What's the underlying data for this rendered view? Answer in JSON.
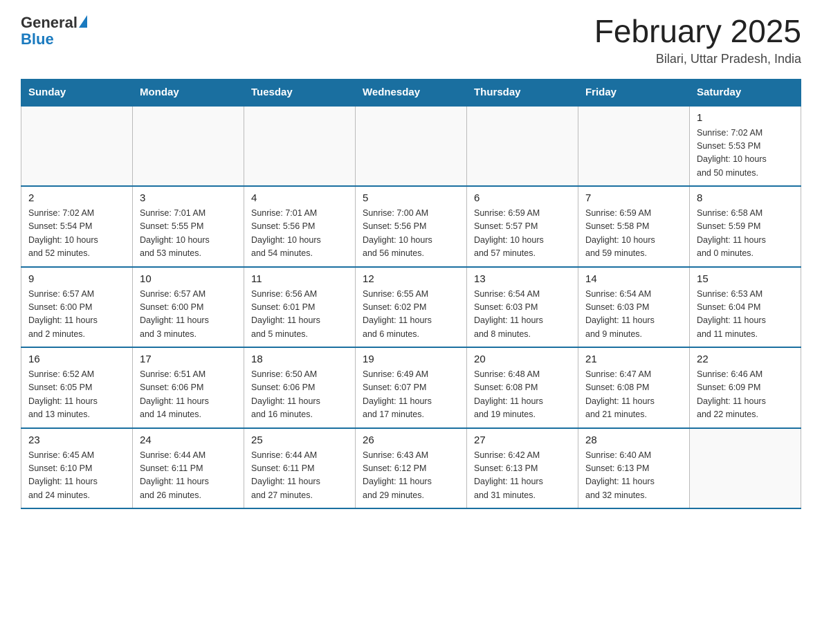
{
  "header": {
    "logo_general": "General",
    "logo_blue": "Blue",
    "title": "February 2025",
    "subtitle": "Bilari, Uttar Pradesh, India"
  },
  "weekdays": [
    "Sunday",
    "Monday",
    "Tuesday",
    "Wednesday",
    "Thursday",
    "Friday",
    "Saturday"
  ],
  "weeks": [
    [
      {
        "day": "",
        "info": ""
      },
      {
        "day": "",
        "info": ""
      },
      {
        "day": "",
        "info": ""
      },
      {
        "day": "",
        "info": ""
      },
      {
        "day": "",
        "info": ""
      },
      {
        "day": "",
        "info": ""
      },
      {
        "day": "1",
        "info": "Sunrise: 7:02 AM\nSunset: 5:53 PM\nDaylight: 10 hours\nand 50 minutes."
      }
    ],
    [
      {
        "day": "2",
        "info": "Sunrise: 7:02 AM\nSunset: 5:54 PM\nDaylight: 10 hours\nand 52 minutes."
      },
      {
        "day": "3",
        "info": "Sunrise: 7:01 AM\nSunset: 5:55 PM\nDaylight: 10 hours\nand 53 minutes."
      },
      {
        "day": "4",
        "info": "Sunrise: 7:01 AM\nSunset: 5:56 PM\nDaylight: 10 hours\nand 54 minutes."
      },
      {
        "day": "5",
        "info": "Sunrise: 7:00 AM\nSunset: 5:56 PM\nDaylight: 10 hours\nand 56 minutes."
      },
      {
        "day": "6",
        "info": "Sunrise: 6:59 AM\nSunset: 5:57 PM\nDaylight: 10 hours\nand 57 minutes."
      },
      {
        "day": "7",
        "info": "Sunrise: 6:59 AM\nSunset: 5:58 PM\nDaylight: 10 hours\nand 59 minutes."
      },
      {
        "day": "8",
        "info": "Sunrise: 6:58 AM\nSunset: 5:59 PM\nDaylight: 11 hours\nand 0 minutes."
      }
    ],
    [
      {
        "day": "9",
        "info": "Sunrise: 6:57 AM\nSunset: 6:00 PM\nDaylight: 11 hours\nand 2 minutes."
      },
      {
        "day": "10",
        "info": "Sunrise: 6:57 AM\nSunset: 6:00 PM\nDaylight: 11 hours\nand 3 minutes."
      },
      {
        "day": "11",
        "info": "Sunrise: 6:56 AM\nSunset: 6:01 PM\nDaylight: 11 hours\nand 5 minutes."
      },
      {
        "day": "12",
        "info": "Sunrise: 6:55 AM\nSunset: 6:02 PM\nDaylight: 11 hours\nand 6 minutes."
      },
      {
        "day": "13",
        "info": "Sunrise: 6:54 AM\nSunset: 6:03 PM\nDaylight: 11 hours\nand 8 minutes."
      },
      {
        "day": "14",
        "info": "Sunrise: 6:54 AM\nSunset: 6:03 PM\nDaylight: 11 hours\nand 9 minutes."
      },
      {
        "day": "15",
        "info": "Sunrise: 6:53 AM\nSunset: 6:04 PM\nDaylight: 11 hours\nand 11 minutes."
      }
    ],
    [
      {
        "day": "16",
        "info": "Sunrise: 6:52 AM\nSunset: 6:05 PM\nDaylight: 11 hours\nand 13 minutes."
      },
      {
        "day": "17",
        "info": "Sunrise: 6:51 AM\nSunset: 6:06 PM\nDaylight: 11 hours\nand 14 minutes."
      },
      {
        "day": "18",
        "info": "Sunrise: 6:50 AM\nSunset: 6:06 PM\nDaylight: 11 hours\nand 16 minutes."
      },
      {
        "day": "19",
        "info": "Sunrise: 6:49 AM\nSunset: 6:07 PM\nDaylight: 11 hours\nand 17 minutes."
      },
      {
        "day": "20",
        "info": "Sunrise: 6:48 AM\nSunset: 6:08 PM\nDaylight: 11 hours\nand 19 minutes."
      },
      {
        "day": "21",
        "info": "Sunrise: 6:47 AM\nSunset: 6:08 PM\nDaylight: 11 hours\nand 21 minutes."
      },
      {
        "day": "22",
        "info": "Sunrise: 6:46 AM\nSunset: 6:09 PM\nDaylight: 11 hours\nand 22 minutes."
      }
    ],
    [
      {
        "day": "23",
        "info": "Sunrise: 6:45 AM\nSunset: 6:10 PM\nDaylight: 11 hours\nand 24 minutes."
      },
      {
        "day": "24",
        "info": "Sunrise: 6:44 AM\nSunset: 6:11 PM\nDaylight: 11 hours\nand 26 minutes."
      },
      {
        "day": "25",
        "info": "Sunrise: 6:44 AM\nSunset: 6:11 PM\nDaylight: 11 hours\nand 27 minutes."
      },
      {
        "day": "26",
        "info": "Sunrise: 6:43 AM\nSunset: 6:12 PM\nDaylight: 11 hours\nand 29 minutes."
      },
      {
        "day": "27",
        "info": "Sunrise: 6:42 AM\nSunset: 6:13 PM\nDaylight: 11 hours\nand 31 minutes."
      },
      {
        "day": "28",
        "info": "Sunrise: 6:40 AM\nSunset: 6:13 PM\nDaylight: 11 hours\nand 32 minutes."
      },
      {
        "day": "",
        "info": ""
      }
    ]
  ]
}
